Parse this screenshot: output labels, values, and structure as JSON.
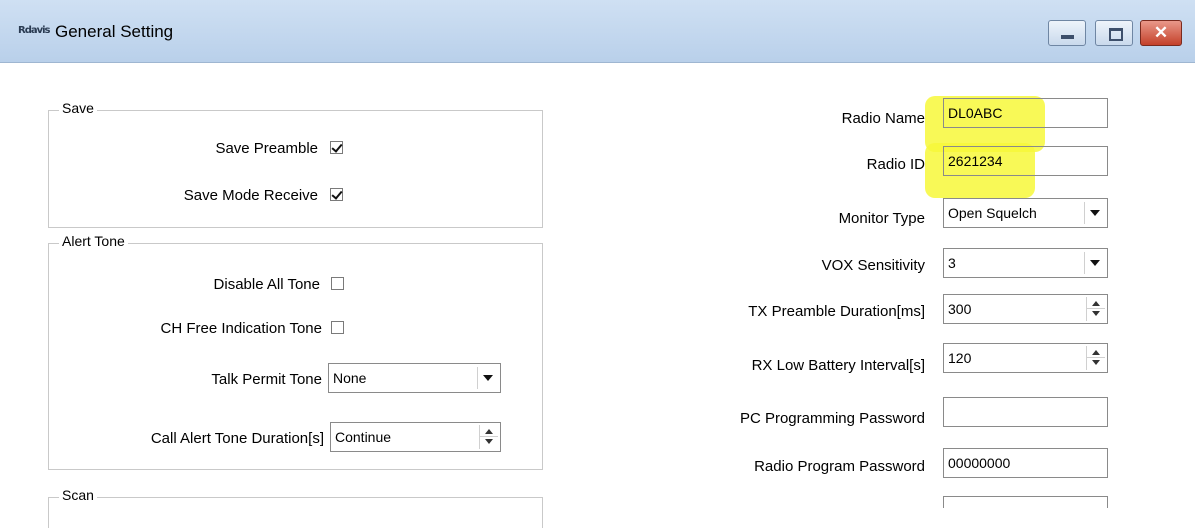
{
  "window": {
    "app_icon_text": "Rdavis",
    "title": "General Setting",
    "minimize_symbol": "",
    "maximize_symbol": "",
    "close_symbol": "✕"
  },
  "save_group": {
    "legend": "Save",
    "save_preamble": {
      "label": "Save Preamble",
      "checked": true
    },
    "save_mode_receive": {
      "label": "Save Mode Receive",
      "checked": true
    }
  },
  "alert_group": {
    "legend": "Alert Tone",
    "disable_all_tone": {
      "label": "Disable All Tone",
      "checked": false
    },
    "ch_free_indication_tone": {
      "label": "CH Free Indication Tone",
      "checked": false
    },
    "talk_permit_tone": {
      "label": "Talk Permit Tone",
      "value": "None"
    },
    "call_alert_tone_duration": {
      "label": "Call Alert Tone Duration[s]",
      "value": "Continue"
    }
  },
  "scan_group": {
    "legend": "Scan"
  },
  "right": {
    "radio_name": {
      "label": "Radio Name",
      "value": "DL0ABC"
    },
    "radio_id": {
      "label": "Radio ID",
      "value": "2621234"
    },
    "monitor_type": {
      "label": "Monitor Type",
      "value": "Open Squelch"
    },
    "vox_sensitivity": {
      "label": "VOX Sensitivity",
      "value": "3"
    },
    "tx_preamble_duration": {
      "label": "TX Preamble Duration[ms]",
      "value": "300"
    },
    "rx_low_battery_interval": {
      "label": "RX Low Battery Interval[s]",
      "value": "120"
    },
    "pc_programming_password": {
      "label": "PC Programming Password",
      "value": ""
    },
    "radio_program_password": {
      "label": "Radio Program Password",
      "value": "00000000"
    }
  },
  "colors": {
    "highlight": "#f7f83a",
    "titlebar": "#c4d8ee",
    "close_button": "#c4412a"
  }
}
